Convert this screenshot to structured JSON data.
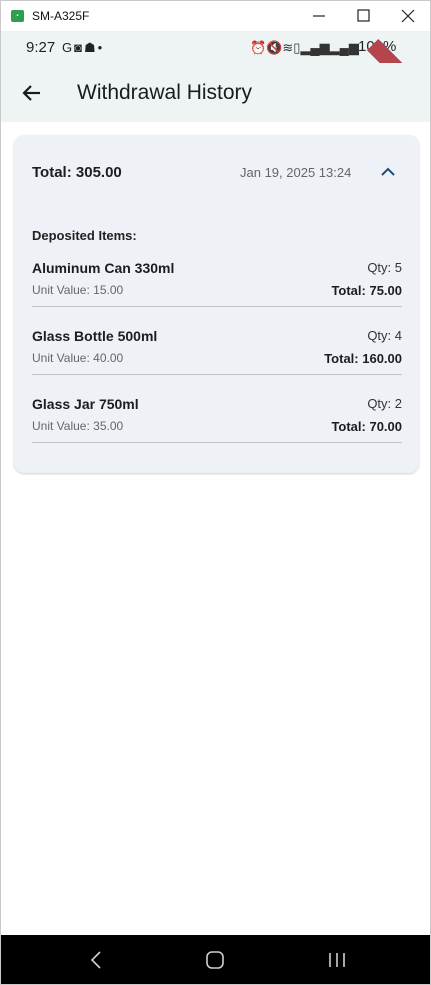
{
  "window": {
    "title": "SM-A325F"
  },
  "status_bar": {
    "time": "9:27",
    "left_icons": [
      "google-icon",
      "discord-icon",
      "incognito-icon",
      "dot-icon"
    ],
    "right_icons": [
      "alarm-icon",
      "mute-icon",
      "wifi-icon",
      "volte-icon",
      "signal-icon",
      "signal-icon"
    ],
    "battery": "100%",
    "debug_banner": "DEBUG"
  },
  "app_bar": {
    "title": "Withdrawal History",
    "back_icon": "arrow-left-icon"
  },
  "withdrawal": {
    "total": "Total: 305.00",
    "date": "Jan 19, 2025 13:24",
    "expand_icon": "chevron-up-icon",
    "items_label": "Deposited Items:",
    "items": [
      {
        "name": "Aluminum Can 330ml",
        "qty": "Qty: 5",
        "unit_value": "Unit Value: 15.00",
        "total": "Total: 75.00"
      },
      {
        "name": "Glass Bottle 500ml",
        "qty": "Qty: 4",
        "unit_value": "Unit Value: 40.00",
        "total": "Total: 160.00"
      },
      {
        "name": "Glass Jar 750ml",
        "qty": "Qty: 2",
        "unit_value": "Unit Value: 35.00",
        "total": "Total: 70.00"
      }
    ]
  },
  "nav_bar": {
    "icons": [
      "back-icon",
      "home-icon",
      "recents-icon"
    ]
  },
  "colors": {
    "app_bar_bg": "#eef4f4",
    "card_bg": "#eef1f5",
    "accent": "#1f4e79",
    "debug_ribbon": "#b4454d"
  }
}
